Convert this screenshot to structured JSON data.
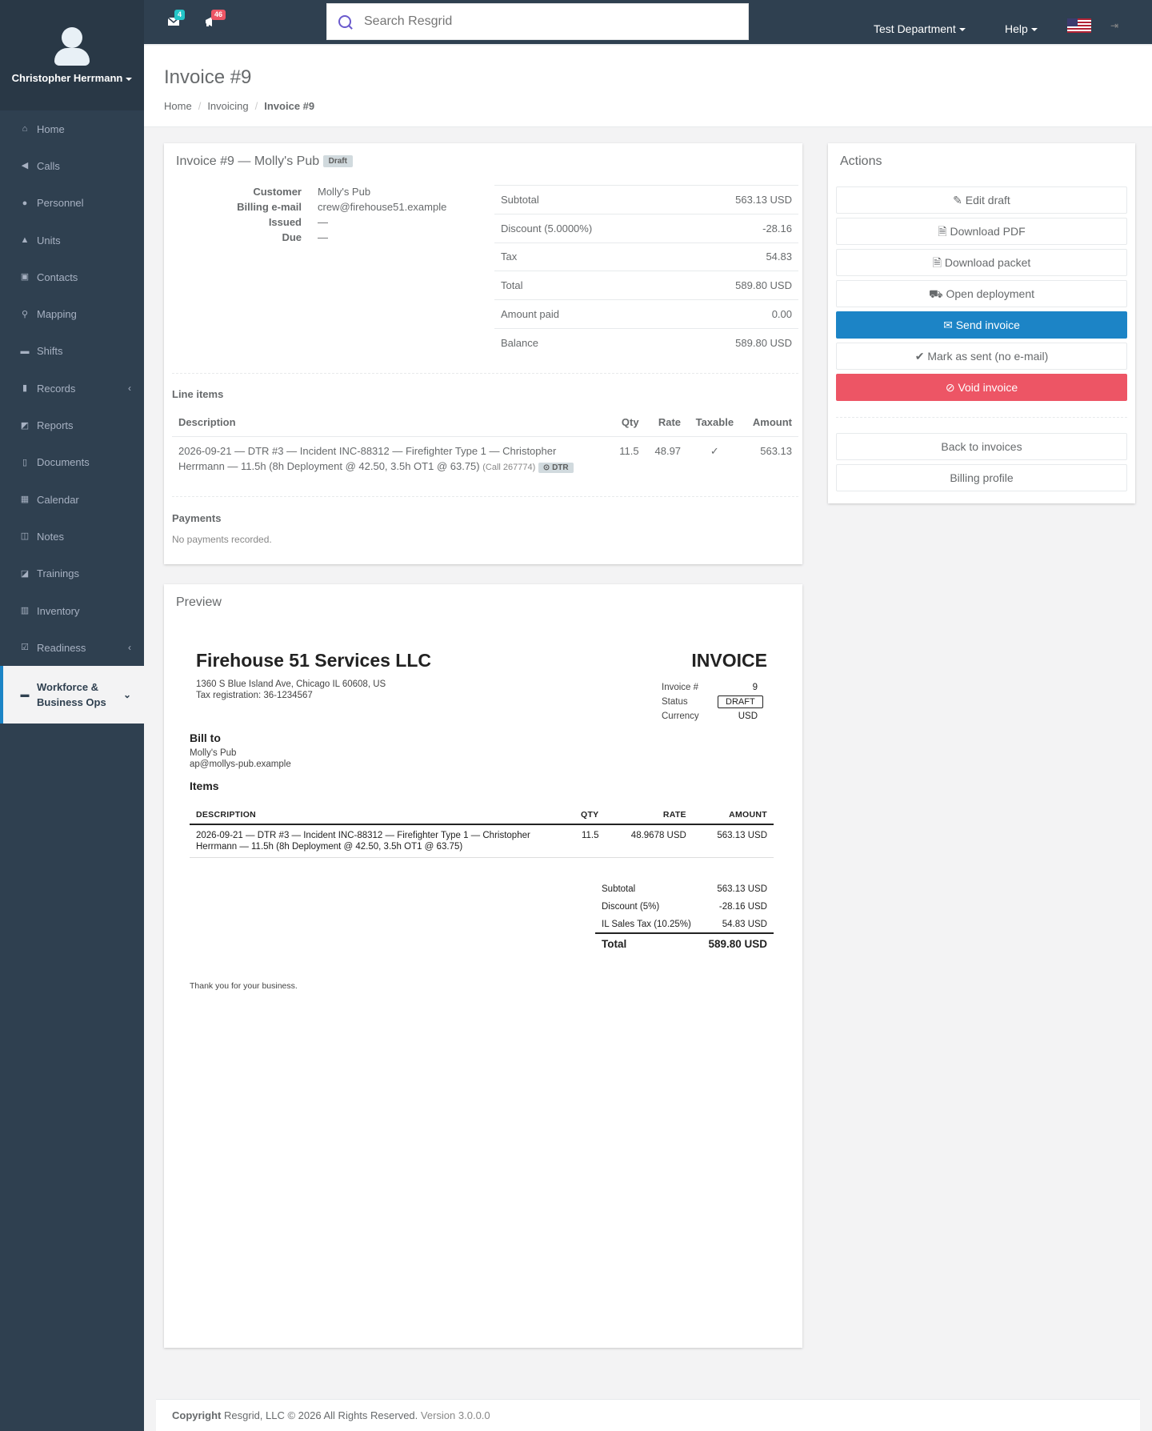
{
  "user": {
    "name": "Christopher Herrmann"
  },
  "sidebar": {
    "items": [
      {
        "label": "Home",
        "icon": "home-icon"
      },
      {
        "label": "Calls",
        "icon": "bullhorn-icon"
      },
      {
        "label": "Personnel",
        "icon": "user-icon"
      },
      {
        "label": "Units",
        "icon": "truck-icon"
      },
      {
        "label": "Contacts",
        "icon": "contact-card-icon"
      },
      {
        "label": "Mapping",
        "icon": "map-pin-icon"
      },
      {
        "label": "Shifts",
        "icon": "briefcase-icon"
      },
      {
        "label": "Records",
        "icon": "file-icon",
        "chevron": "‹"
      },
      {
        "label": "Reports",
        "icon": "report-icon"
      },
      {
        "label": "Documents",
        "icon": "document-icon"
      },
      {
        "label": "Calendar",
        "icon": "calendar-icon"
      },
      {
        "label": "Notes",
        "icon": "notes-icon"
      },
      {
        "label": "Trainings",
        "icon": "book-icon"
      },
      {
        "label": "Inventory",
        "icon": "barcode-icon"
      },
      {
        "label": "Readiness",
        "icon": "checkbox-icon",
        "chevron": "‹"
      }
    ],
    "active_item": {
      "label_line1": "Workforce &",
      "label_line2": "Business Ops",
      "icon": "briefcase-icon"
    }
  },
  "topbar": {
    "messages_count": "4",
    "alerts_count": "46",
    "search_placeholder": "Search Resgrid",
    "department": "Test Department",
    "help": "Help",
    "colors": {
      "messages_badge": "#23c6c8",
      "alerts_badge": "#ed5565"
    }
  },
  "page": {
    "title": "Invoice #9",
    "breadcrumb": [
      "Home",
      "Invoicing",
      "Invoice #9"
    ]
  },
  "invoice": {
    "title": "Invoice #9 — Molly's Pub",
    "status": "Draft",
    "fields": [
      {
        "k": "Customer",
        "v": "Molly's Pub"
      },
      {
        "k": "Billing e-mail",
        "v": "crew@firehouse51.example"
      },
      {
        "k": "Issued",
        "v": "—"
      },
      {
        "k": "Due",
        "v": "—"
      }
    ],
    "summary": [
      {
        "k": "Subtotal",
        "v": "563.13 USD"
      },
      {
        "k": "Discount (5.0000%)",
        "v": "-28.16"
      },
      {
        "k": "Tax",
        "v": "54.83"
      },
      {
        "k": "Total",
        "v": "589.80 USD"
      },
      {
        "k": "Amount paid",
        "v": "0.00"
      },
      {
        "k": "Balance",
        "v": "589.80 USD"
      }
    ],
    "line_items_title": "Line items",
    "line_headers": {
      "desc": "Description",
      "qty": "Qty",
      "rate": "Rate",
      "taxable": "Taxable",
      "amount": "Amount"
    },
    "line_items": [
      {
        "desc": "2026-09-21 — DTR #3 — Incident INC-88312 — Firefighter Type 1 — Christopher Herrmann — 11.5h (8h Deployment @ 42.50, 3.5h OT1 @ 63.75)",
        "call": "(Call 267774)",
        "tag": "⊙ DTR",
        "qty": "11.5",
        "rate": "48.97",
        "taxable": "✓",
        "amount": "563.13"
      }
    ],
    "payments_title": "Payments",
    "payments_empty": "No payments recorded."
  },
  "actions": {
    "title": "Actions",
    "buttons": [
      {
        "label": "Edit draft",
        "icon": "✎"
      },
      {
        "label": "Download PDF",
        "icon": "🗎"
      },
      {
        "label": "Download packet",
        "icon": "🗎"
      },
      {
        "label": "Open deployment",
        "icon": "⛟"
      },
      {
        "label": "Send invoice",
        "icon": "✉"
      },
      {
        "label": "Mark as sent (no e-mail)",
        "icon": "✔"
      },
      {
        "label": "Void invoice",
        "icon": "⊘"
      }
    ],
    "back": "Back to invoices",
    "billing": "Billing profile",
    "colors": {
      "primary": "#1c84c6",
      "danger": "#ed5565"
    }
  },
  "preview": {
    "title": "Preview",
    "company": "Firehouse 51 Services LLC",
    "address": "1360 S Blue Island Ave, Chicago IL 60608, US",
    "tax_reg": "Tax registration: 36-1234567",
    "doc_title": "INVOICE",
    "meta": [
      {
        "k": "Invoice #",
        "v": "9"
      },
      {
        "k": "Status",
        "v": "DRAFT"
      },
      {
        "k": "Currency",
        "v": "USD"
      }
    ],
    "bill_to_title": "Bill to",
    "bill_to_name": "Molly's Pub",
    "bill_to_email": "ap@mollys-pub.example",
    "items_title": "Items",
    "headers": {
      "desc": "DESCRIPTION",
      "qty": "QTY",
      "rate": "RATE",
      "amount": "AMOUNT"
    },
    "items": [
      {
        "desc": "2026-09-21 — DTR #3 — Incident INC-88312 — Firefighter Type 1 — Christopher Herrmann — 11.5h (8h Deployment @ 42.50, 3.5h OT1 @ 63.75)",
        "qty": "11.5",
        "rate": "48.9678 USD",
        "amount": "563.13 USD"
      }
    ],
    "totals": [
      {
        "k": "Subtotal",
        "v": "563.13 USD"
      },
      {
        "k": "Discount (5%)",
        "v": "-28.16 USD"
      },
      {
        "k": "IL Sales Tax (10.25%)",
        "v": "54.83 USD"
      }
    ],
    "total": {
      "k": "Total",
      "v": "589.80 USD"
    },
    "thanks": "Thank you for your business."
  },
  "footer": {
    "copyright": "Copyright",
    "company": "Resgrid, LLC © 2026 All Rights Reserved.",
    "version": "Version 3.0.0.0"
  }
}
